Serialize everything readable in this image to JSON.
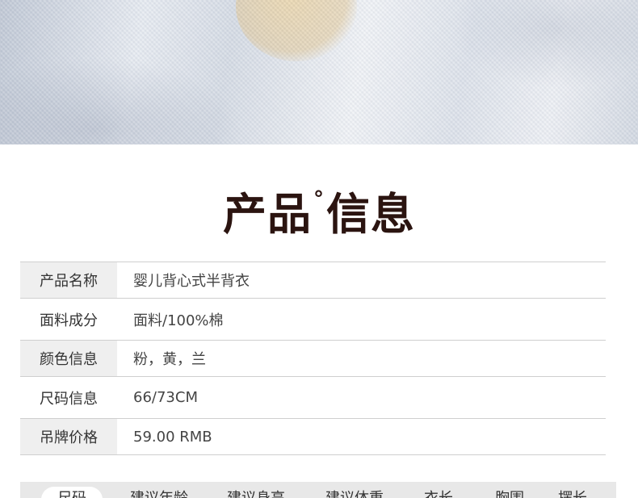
{
  "section_title": {
    "main_left": "产品",
    "degree": "°",
    "main_right": "信息"
  },
  "specs": [
    {
      "label": "产品名称",
      "value": "婴儿背心式半背衣"
    },
    {
      "label": "面料成分",
      "value": "面料/100%棉"
    },
    {
      "label": "颜色信息",
      "value": "粉，黄，兰"
    },
    {
      "label": "尺码信息",
      "value": "66/73CM"
    },
    {
      "label": "吊牌价格",
      "value": "59.00 RMB"
    }
  ],
  "size_table": {
    "headers": [
      "尺码",
      "建议年龄",
      "建议身高",
      "建议体重",
      "衣长",
      "胸围",
      "摆长"
    ]
  }
}
